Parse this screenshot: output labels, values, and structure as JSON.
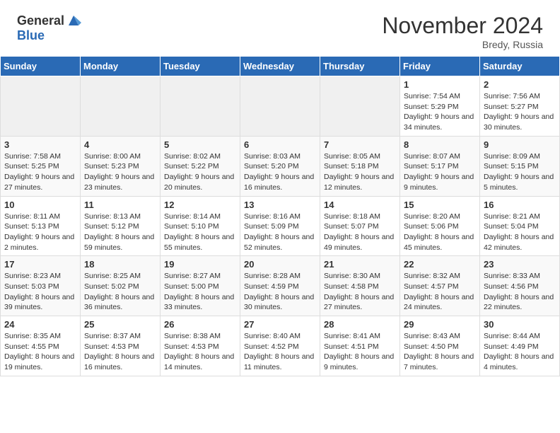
{
  "header": {
    "logo_general": "General",
    "logo_blue": "Blue",
    "month": "November 2024",
    "location": "Bredy, Russia"
  },
  "weekdays": [
    "Sunday",
    "Monday",
    "Tuesday",
    "Wednesday",
    "Thursday",
    "Friday",
    "Saturday"
  ],
  "weeks": [
    [
      {
        "day": "",
        "info": ""
      },
      {
        "day": "",
        "info": ""
      },
      {
        "day": "",
        "info": ""
      },
      {
        "day": "",
        "info": ""
      },
      {
        "day": "",
        "info": ""
      },
      {
        "day": "1",
        "info": "Sunrise: 7:54 AM\nSunset: 5:29 PM\nDaylight: 9 hours and 34 minutes."
      },
      {
        "day": "2",
        "info": "Sunrise: 7:56 AM\nSunset: 5:27 PM\nDaylight: 9 hours and 30 minutes."
      }
    ],
    [
      {
        "day": "3",
        "info": "Sunrise: 7:58 AM\nSunset: 5:25 PM\nDaylight: 9 hours and 27 minutes."
      },
      {
        "day": "4",
        "info": "Sunrise: 8:00 AM\nSunset: 5:23 PM\nDaylight: 9 hours and 23 minutes."
      },
      {
        "day": "5",
        "info": "Sunrise: 8:02 AM\nSunset: 5:22 PM\nDaylight: 9 hours and 20 minutes."
      },
      {
        "day": "6",
        "info": "Sunrise: 8:03 AM\nSunset: 5:20 PM\nDaylight: 9 hours and 16 minutes."
      },
      {
        "day": "7",
        "info": "Sunrise: 8:05 AM\nSunset: 5:18 PM\nDaylight: 9 hours and 12 minutes."
      },
      {
        "day": "8",
        "info": "Sunrise: 8:07 AM\nSunset: 5:17 PM\nDaylight: 9 hours and 9 minutes."
      },
      {
        "day": "9",
        "info": "Sunrise: 8:09 AM\nSunset: 5:15 PM\nDaylight: 9 hours and 5 minutes."
      }
    ],
    [
      {
        "day": "10",
        "info": "Sunrise: 8:11 AM\nSunset: 5:13 PM\nDaylight: 9 hours and 2 minutes."
      },
      {
        "day": "11",
        "info": "Sunrise: 8:13 AM\nSunset: 5:12 PM\nDaylight: 8 hours and 59 minutes."
      },
      {
        "day": "12",
        "info": "Sunrise: 8:14 AM\nSunset: 5:10 PM\nDaylight: 8 hours and 55 minutes."
      },
      {
        "day": "13",
        "info": "Sunrise: 8:16 AM\nSunset: 5:09 PM\nDaylight: 8 hours and 52 minutes."
      },
      {
        "day": "14",
        "info": "Sunrise: 8:18 AM\nSunset: 5:07 PM\nDaylight: 8 hours and 49 minutes."
      },
      {
        "day": "15",
        "info": "Sunrise: 8:20 AM\nSunset: 5:06 PM\nDaylight: 8 hours and 45 minutes."
      },
      {
        "day": "16",
        "info": "Sunrise: 8:21 AM\nSunset: 5:04 PM\nDaylight: 8 hours and 42 minutes."
      }
    ],
    [
      {
        "day": "17",
        "info": "Sunrise: 8:23 AM\nSunset: 5:03 PM\nDaylight: 8 hours and 39 minutes."
      },
      {
        "day": "18",
        "info": "Sunrise: 8:25 AM\nSunset: 5:02 PM\nDaylight: 8 hours and 36 minutes."
      },
      {
        "day": "19",
        "info": "Sunrise: 8:27 AM\nSunset: 5:00 PM\nDaylight: 8 hours and 33 minutes."
      },
      {
        "day": "20",
        "info": "Sunrise: 8:28 AM\nSunset: 4:59 PM\nDaylight: 8 hours and 30 minutes."
      },
      {
        "day": "21",
        "info": "Sunrise: 8:30 AM\nSunset: 4:58 PM\nDaylight: 8 hours and 27 minutes."
      },
      {
        "day": "22",
        "info": "Sunrise: 8:32 AM\nSunset: 4:57 PM\nDaylight: 8 hours and 24 minutes."
      },
      {
        "day": "23",
        "info": "Sunrise: 8:33 AM\nSunset: 4:56 PM\nDaylight: 8 hours and 22 minutes."
      }
    ],
    [
      {
        "day": "24",
        "info": "Sunrise: 8:35 AM\nSunset: 4:55 PM\nDaylight: 8 hours and 19 minutes."
      },
      {
        "day": "25",
        "info": "Sunrise: 8:37 AM\nSunset: 4:53 PM\nDaylight: 8 hours and 16 minutes."
      },
      {
        "day": "26",
        "info": "Sunrise: 8:38 AM\nSunset: 4:53 PM\nDaylight: 8 hours and 14 minutes."
      },
      {
        "day": "27",
        "info": "Sunrise: 8:40 AM\nSunset: 4:52 PM\nDaylight: 8 hours and 11 minutes."
      },
      {
        "day": "28",
        "info": "Sunrise: 8:41 AM\nSunset: 4:51 PM\nDaylight: 8 hours and 9 minutes."
      },
      {
        "day": "29",
        "info": "Sunrise: 8:43 AM\nSunset: 4:50 PM\nDaylight: 8 hours and 7 minutes."
      },
      {
        "day": "30",
        "info": "Sunrise: 8:44 AM\nSunset: 4:49 PM\nDaylight: 8 hours and 4 minutes."
      }
    ]
  ]
}
